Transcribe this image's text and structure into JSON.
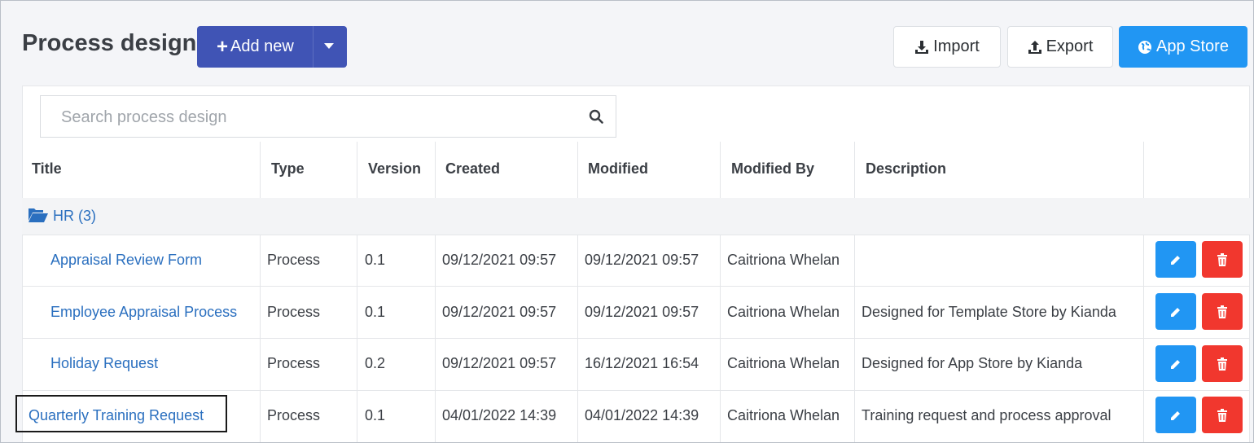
{
  "header": {
    "title": "Process design",
    "add_label": "Add new",
    "import_label": "Import",
    "export_label": "Export",
    "store_label": "App Store"
  },
  "search": {
    "placeholder": "Search process design"
  },
  "columns": [
    "Title",
    "Type",
    "Version",
    "Created",
    "Modified",
    "Modified By",
    "Description"
  ],
  "group": {
    "label": "HR (3)"
  },
  "rows": [
    {
      "title": "Appraisal Review Form",
      "type": "Process",
      "version": "0.1",
      "created": "09/12/2021 09:57",
      "modified": "09/12/2021 09:57",
      "modified_by": "Caitriona Whelan",
      "description": ""
    },
    {
      "title": "Employee Appraisal Process",
      "type": "Process",
      "version": "0.1",
      "created": "09/12/2021 09:57",
      "modified": "09/12/2021 09:57",
      "modified_by": "Caitriona Whelan",
      "description": "Designed for Template Store by Kianda"
    },
    {
      "title": "Holiday Request",
      "type": "Process",
      "version": "0.2",
      "created": "09/12/2021 09:57",
      "modified": "16/12/2021 16:54",
      "modified_by": "Caitriona Whelan",
      "description": "Designed for App Store by Kianda"
    },
    {
      "title": "Quarterly Training Request",
      "type": "Process",
      "version": "0.1",
      "created": "04/01/2022 14:39",
      "modified": "04/01/2022 14:39",
      "modified_by": "Caitriona Whelan",
      "description": "Training request and process approval"
    }
  ],
  "colors": {
    "primary": "#4054b5",
    "accent": "#2196f3",
    "danger": "#f1372e",
    "link": "#2a6fbf"
  },
  "icons": {
    "add": "plus-icon",
    "import": "download-icon",
    "export": "upload-icon",
    "store": "globe-icon",
    "search": "search-icon",
    "folder": "folder-open-icon",
    "edit": "pencil-icon",
    "delete": "trash-icon"
  }
}
